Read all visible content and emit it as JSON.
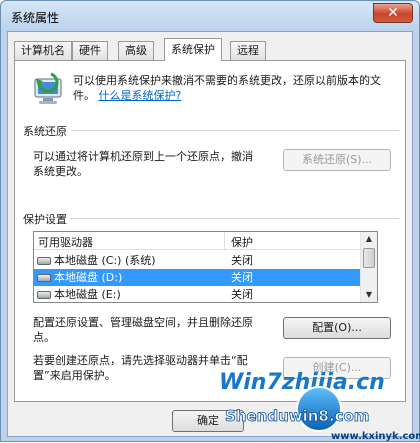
{
  "window": {
    "title": "系统属性",
    "close_glyph": "✕"
  },
  "tabs": [
    {
      "label": "计算机名"
    },
    {
      "label": "硬件"
    },
    {
      "label": "高级"
    },
    {
      "label": "系统保护",
      "active": true
    },
    {
      "label": "远程"
    }
  ],
  "header": {
    "text": "可以使用系统保护来撤消不需要的系统更改，还原以前版本的文件。",
    "link": "什么是系统保护?"
  },
  "restore": {
    "title": "系统还原",
    "desc": "可以通过将计算机还原到上一个还原点，撤消系统更改。",
    "button": "系统还原(S)..."
  },
  "protection": {
    "title": "保护设置",
    "columns": {
      "drive": "可用驱动器",
      "protect": "保护"
    },
    "rows": [
      {
        "name": "本地磁盘 (C:) (系统)",
        "protect": "关闭",
        "selected": false
      },
      {
        "name": "本地磁盘 (D:)",
        "protect": "关闭",
        "selected": true
      },
      {
        "name": "本地磁盘 (E:)",
        "protect": "关闭",
        "selected": false
      }
    ],
    "configure_desc": "配置还原设置、管理磁盘空间，并且删除还原点。",
    "configure_button": "配置(O)...",
    "create_desc": "若要创建还原点，请先选择驱动器并单击“配置”来启用保护。",
    "create_button": "创建(C)..."
  },
  "footer": {
    "ok_button": "确定"
  },
  "watermark": {
    "brand1": "Win7zhijia.cn",
    "brand2": "Shenduwin8.com",
    "url": "www.kxinyk.com"
  },
  "colors": {
    "selection": "#3399ff",
    "link": "#0066cc",
    "close": "#c8452a"
  }
}
